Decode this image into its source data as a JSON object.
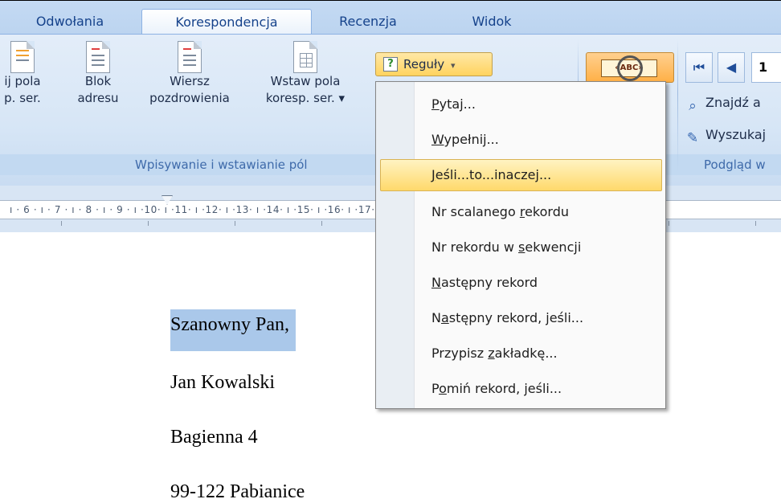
{
  "tabs": {
    "items": [
      {
        "label": "Odwołania",
        "active": false
      },
      {
        "label": "Korespondencja",
        "active": true
      },
      {
        "label": "Recenzja",
        "active": false
      },
      {
        "label": "Widok",
        "active": false
      }
    ]
  },
  "ribbon": {
    "buttons": {
      "wyroznij_line1": "ij pola",
      "wyroznij_line2": "p. ser.",
      "blok_line1": "Blok",
      "blok_line2": "adresu",
      "wiersz_line1": "Wiersz",
      "wiersz_line2": "pozdrowienia",
      "wstaw_line1": "Wstaw pola",
      "wstaw_line2": "koresp. ser. ▾",
      "reguly": "Reguły",
      "reguly_arrow": "▾",
      "preview_abc": "«ABC»",
      "record_value": "1",
      "znajdz": "Znajdź a",
      "wyszukaj": "Wyszukaj"
    },
    "groups": {
      "wpisywanie": "Wpisywanie i wstawianie pól",
      "podglad": "Podgląd w"
    }
  },
  "ruler": {
    "text": "ı · 6 · ı · 7 · ı · 8 · ı · 9 · ı ·10· ı ·11· ı ·12· ı ·13· ı ·14· ı ·15· ı ·16· ı ·17· ı ·18"
  },
  "document": {
    "lines": [
      "Szanowny Pan,",
      "Jan Kowalski",
      "Bagienna 4",
      "99-122 Pabianice"
    ]
  },
  "menu": {
    "items": [
      {
        "pre": "",
        "key": "P",
        "post": "ytaj...",
        "highlighted": false
      },
      {
        "pre": "",
        "key": "W",
        "post": "ypełnij...",
        "highlighted": false
      },
      {
        "pre": "",
        "key": "J",
        "post": "eśli...to...inaczej...",
        "highlighted": true
      },
      {
        "pre": "Nr scalanego ",
        "key": "r",
        "post": "ekordu",
        "highlighted": false
      },
      {
        "pre": "Nr rekordu w ",
        "key": "s",
        "post": "ekwencji",
        "highlighted": false
      },
      {
        "pre": "",
        "key": "N",
        "post": "astępny rekord",
        "highlighted": false
      },
      {
        "pre": "N",
        "key": "a",
        "post": "stępny rekord, jeśli...",
        "highlighted": false
      },
      {
        "pre": "Przypisz ",
        "key": "z",
        "post": "akładkę...",
        "highlighted": false
      },
      {
        "pre": "P",
        "key": "o",
        "post": "miń rekord, jeśli...",
        "highlighted": false
      }
    ]
  },
  "colors": {
    "ribbon_bg": "#dbe8f7",
    "tab_text": "#15428b",
    "menu_highlight": "#ffd96b",
    "selection": "#aac8ea"
  }
}
